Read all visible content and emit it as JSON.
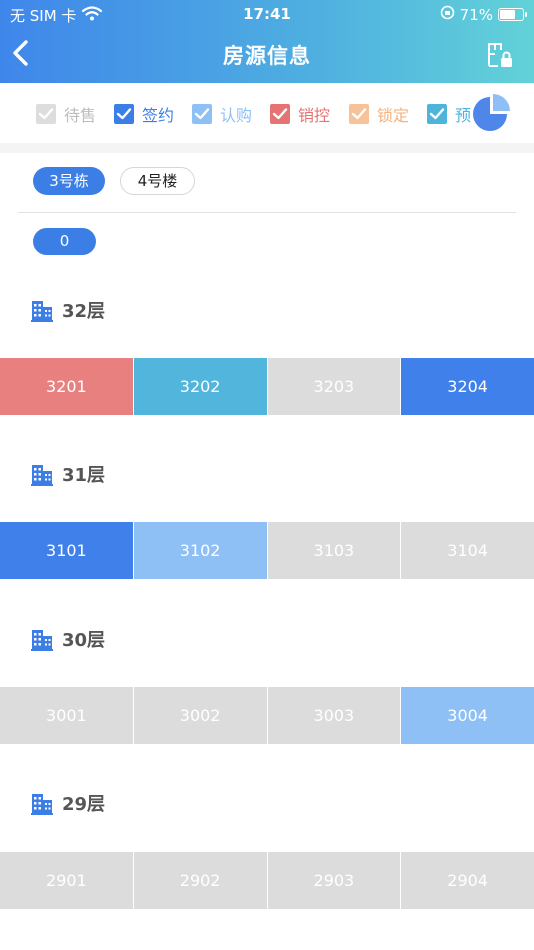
{
  "status_bar": {
    "carrier": "无 SIM 卡",
    "time": "17:41",
    "battery": "71%",
    "battery_level": 0.71
  },
  "nav": {
    "title": "房源信息"
  },
  "filters": [
    {
      "label": "待售",
      "color": "#dddddd",
      "text_color": "#bdbdbd",
      "checked": true
    },
    {
      "label": "签约",
      "color": "#3b7fe6",
      "text_color": "#3b7fe6",
      "checked": true
    },
    {
      "label": "认购",
      "color": "#8ec0f6",
      "text_color": "#8ec0f6",
      "checked": true
    },
    {
      "label": "销控",
      "color": "#e57373",
      "text_color": "#e57373",
      "checked": true
    },
    {
      "label": "锁定",
      "color": "#f5c29a",
      "text_color": "#f5b27e",
      "checked": true
    },
    {
      "label": "预",
      "color": "#4fb4dc",
      "text_color": "#4fb4dc",
      "checked": true
    }
  ],
  "buildings": [
    {
      "label": "3号栋",
      "active": true
    },
    {
      "label": "4号楼",
      "active": false
    }
  ],
  "unit_filter": "0",
  "floors": [
    {
      "label": "32层",
      "rooms": [
        {
          "number": "3201",
          "color": "#e98080"
        },
        {
          "number": "3202",
          "color": "#52b5dc"
        },
        {
          "number": "3203",
          "color": "#dcdcdc"
        },
        {
          "number": "3204",
          "color": "#3f80ea"
        }
      ]
    },
    {
      "label": "31层",
      "rooms": [
        {
          "number": "3101",
          "color": "#3f80ea"
        },
        {
          "number": "3102",
          "color": "#8ec0f6"
        },
        {
          "number": "3103",
          "color": "#dcdcdc"
        },
        {
          "number": "3104",
          "color": "#dcdcdc"
        }
      ]
    },
    {
      "label": "30层",
      "rooms": [
        {
          "number": "3001",
          "color": "#dcdcdc"
        },
        {
          "number": "3002",
          "color": "#dcdcdc"
        },
        {
          "number": "3003",
          "color": "#dcdcdc"
        },
        {
          "number": "3004",
          "color": "#8ec0f6"
        }
      ]
    },
    {
      "label": "29层",
      "rooms": [
        {
          "number": "2901",
          "color": "#dcdcdc"
        },
        {
          "number": "2902",
          "color": "#dcdcdc"
        },
        {
          "number": "2903",
          "color": "#dcdcdc"
        },
        {
          "number": "2904",
          "color": "#dcdcdc"
        }
      ]
    }
  ]
}
